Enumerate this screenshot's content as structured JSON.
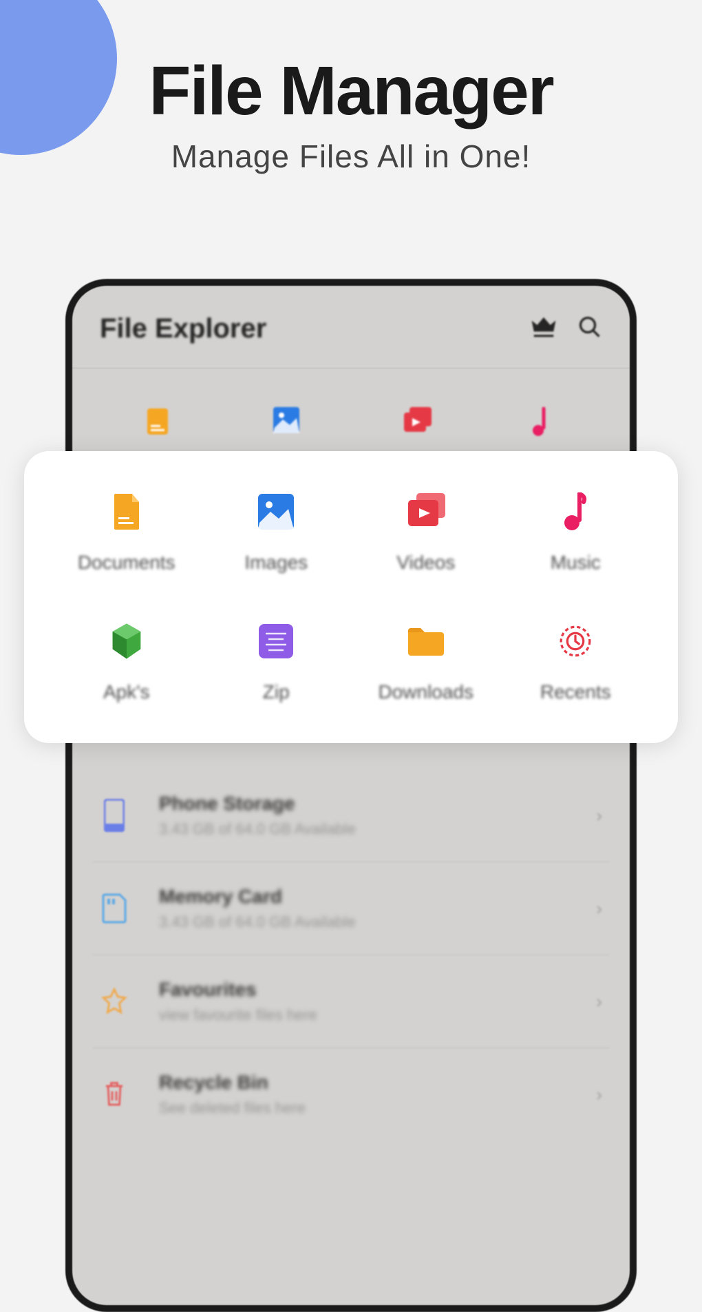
{
  "hero": {
    "title": "File Manager",
    "subtitle": "Manage Files All in One!"
  },
  "phone": {
    "title": "File Explorer",
    "miniIcons": [
      "document-icon",
      "image-icon",
      "video-icon",
      "music-icon"
    ],
    "storage": [
      {
        "icon": "phone-storage-icon",
        "color": "#6a7ee8",
        "title": "Phone Storage",
        "sub": "3.43 GB of 64.0 GB Available"
      },
      {
        "icon": "sdcard-icon",
        "color": "#5aa8e6",
        "title": "Memory Card",
        "sub": "3.43 GB of 64.0 GB Available"
      },
      {
        "icon": "star-outline-icon",
        "color": "#f0a94a",
        "title": "Favourites",
        "sub": "view favourite files here"
      },
      {
        "icon": "trash-icon",
        "color": "#e45a5a",
        "title": "Recycle Bin",
        "sub": "See deleted files here"
      }
    ]
  },
  "popup": {
    "items": [
      {
        "icon": "document-icon",
        "color": "#f5a623",
        "label": "Documents"
      },
      {
        "icon": "image-icon",
        "color": "#2a7be4",
        "label": "Images"
      },
      {
        "icon": "video-icon",
        "color": "#e63946",
        "label": "Videos"
      },
      {
        "icon": "music-icon",
        "color": "#e91e63",
        "label": "Music"
      },
      {
        "icon": "apk-icon",
        "color": "#3fa93f",
        "label": "Apk's"
      },
      {
        "icon": "zip-icon",
        "color": "#8f5ce8",
        "label": "Zip"
      },
      {
        "icon": "download-icon",
        "color": "#f5a623",
        "label": "Downloads"
      },
      {
        "icon": "recent-icon",
        "color": "#e63946",
        "label": "Recents"
      }
    ]
  }
}
